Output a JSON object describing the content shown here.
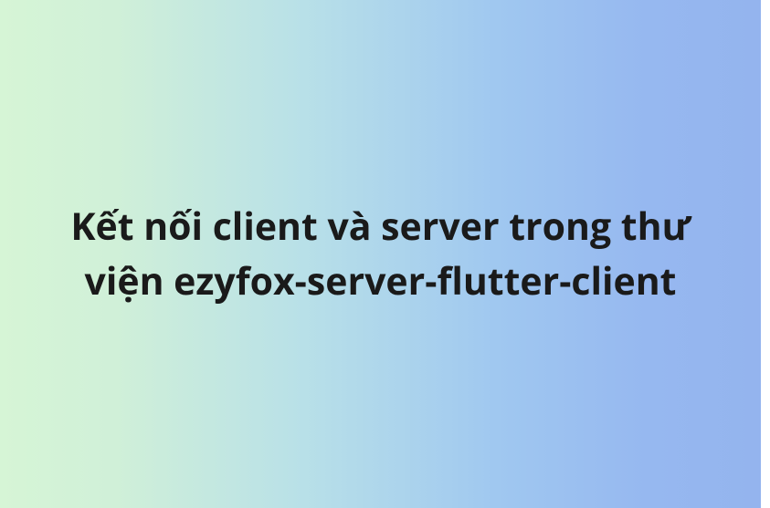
{
  "title": "Kết nối client và server trong thư viện ezyfox-server-flutter-client"
}
